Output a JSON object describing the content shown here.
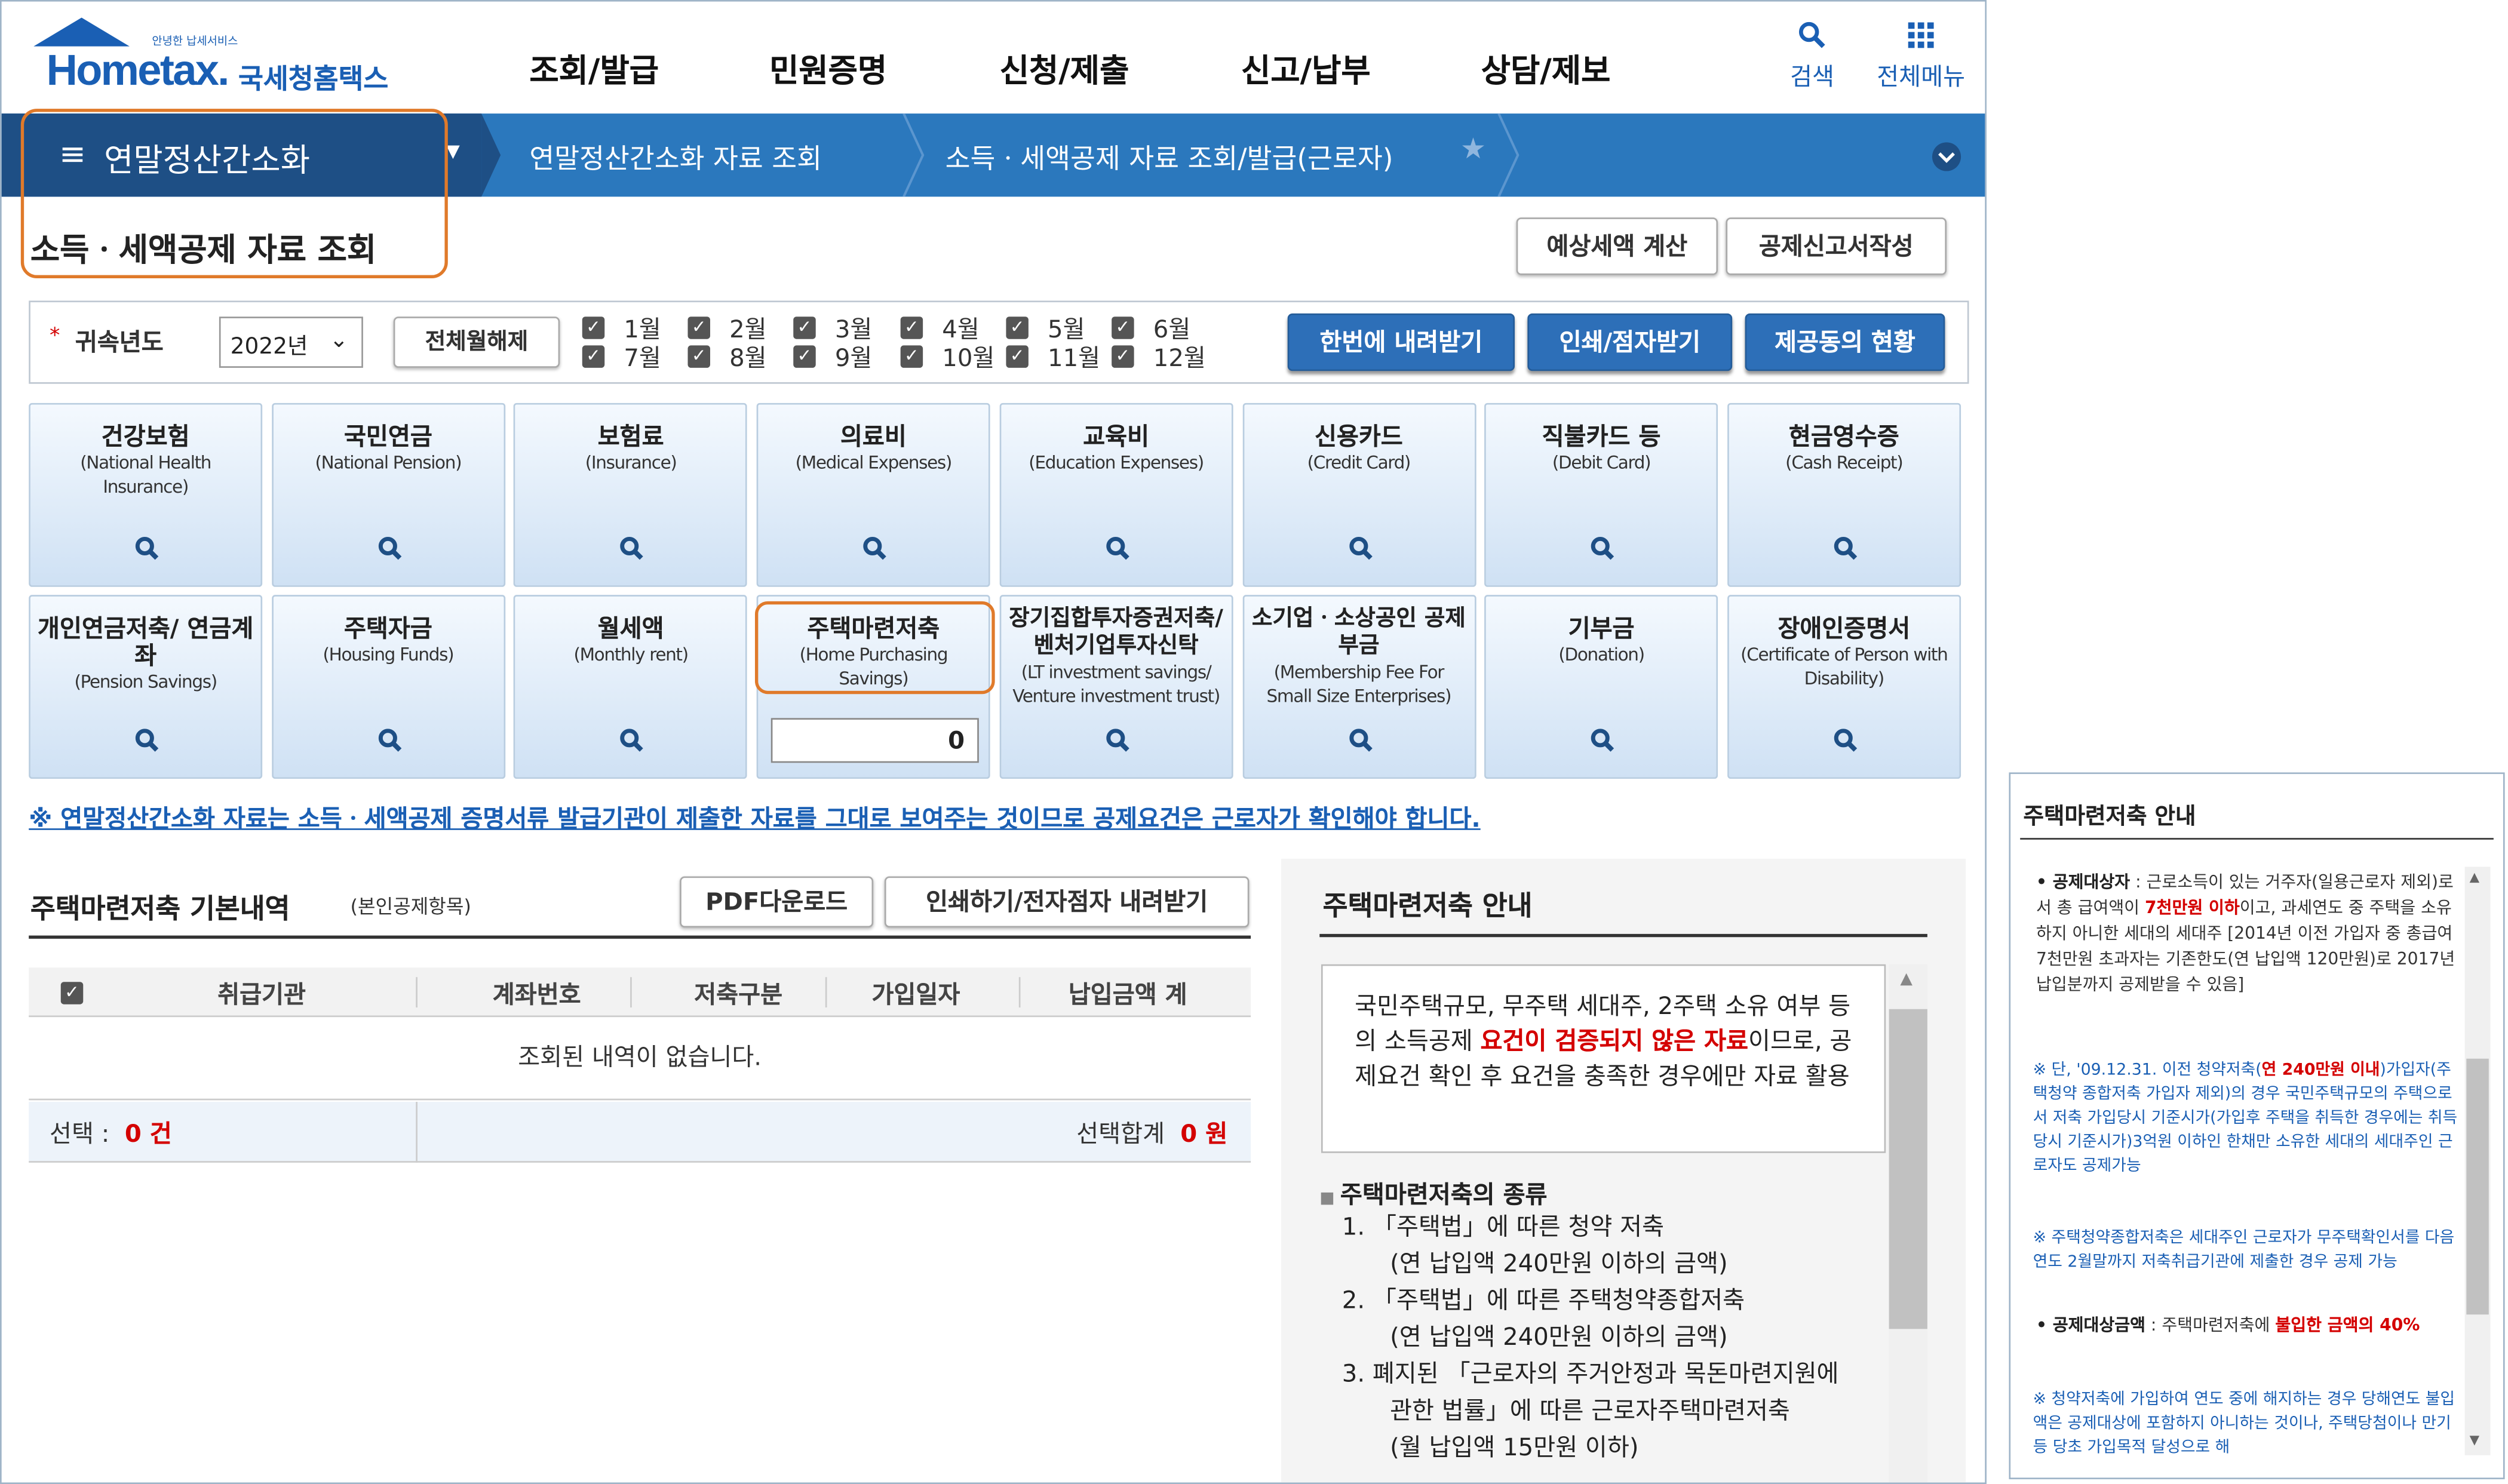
{
  "header": {
    "logo_small": "안녕한 납세서비스",
    "logo_word": "Hometax.",
    "logo_ko": "국세청홈택스",
    "gnb": [
      "조회/발급",
      "민원증명",
      "신청/제출",
      "신고/납부",
      "상담/제보"
    ],
    "search": "검색",
    "menu": "전체메뉴"
  },
  "nav": {
    "home": "연말정산간소화",
    "crumb1": "연말정산간소화 자료 조회",
    "crumb2": "소득ㆍ세액공제 자료 조회/발급(근로자)"
  },
  "page_title": "소득ㆍ세액공제 자료 조회",
  "top_buttons": [
    "예상세액 계산",
    "공제신고서작성"
  ],
  "filter": {
    "year_label": "귀속년도",
    "year_value": "2022년",
    "clear_label": "전체월해제",
    "months_top": [
      "1월",
      "2월",
      "3월",
      "4월",
      "5월",
      "6월"
    ],
    "months_bottom": [
      "7월",
      "8월",
      "9월",
      "10월",
      "11월",
      "12월"
    ],
    "btn_download": "한번에 내려받기",
    "btn_print": "인쇄/점자받기",
    "btn_consent": "제공동의 현황"
  },
  "cards_row1": [
    {
      "k": "건강보험",
      "e": "(National Health Insurance)"
    },
    {
      "k": "국민연금",
      "e": "(National Pension)"
    },
    {
      "k": "보험료",
      "e": "(Insurance)"
    },
    {
      "k": "의료비",
      "e": "(Medical Expenses)"
    },
    {
      "k": "교육비",
      "e": "(Education Expenses)"
    },
    {
      "k": "신용카드",
      "e": "(Credit Card)"
    },
    {
      "k": "직불카드 등",
      "e": "(Debit Card)"
    },
    {
      "k": "현금영수증",
      "e": "(Cash Receipt)"
    }
  ],
  "cards_row2": [
    {
      "k": "개인연금저축/ 연금계좌",
      "e": "(Pension Savings)"
    },
    {
      "k": "주택자금",
      "e": "(Housing Funds)"
    },
    {
      "k": "월세액",
      "e": "(Monthly rent)"
    },
    {
      "k": "주택마련저축",
      "e": "(Home Purchasing Savings)",
      "value": "0"
    },
    {
      "k": "장기집합투자증권저축/ 벤처기업투자신탁",
      "e": "(LT investment savings/ Venture investment trust)"
    },
    {
      "k": "소기업ㆍ소상공인 공제부금",
      "e": "(Membership Fee For Small Size Enterprises)"
    },
    {
      "k": "기부금",
      "e": "(Donation)"
    },
    {
      "k": "장애인증명서",
      "e": "(Certificate of Person with Disability)"
    }
  ],
  "notice": "※ 연말정산간소화 자료는 소득ㆍ세액공제 증명서류 발급기관이 제출한 자료를 그대로 보여주는 것이므로 공제요건은 근로자가 확인해야 합니다.",
  "detail": {
    "title": "주택마련저축 기본내역",
    "title_sub": "(본인공제항목)",
    "btn_pdf": "PDF다운로드",
    "btn_print": "인쇄하기/전자점자 내려받기",
    "columns": [
      "취급기관",
      "계좌번호",
      "저축구분",
      "가입일자",
      "납입금액 계"
    ],
    "empty": "조회된 내역이 없습니다.",
    "sel_label": "선택 :",
    "sel_count": "0 건",
    "sum_label": "선택합계",
    "sum_value": "0 원"
  },
  "guide": {
    "title": "주택마련저축 안내",
    "box_a": "국민주택규모, 무주택 세대주, 2주택 소유 여부 등의 소득공제 ",
    "box_red": "요건이 검증되지 않은 자료",
    "box_b": "이므로, 공제요건 확인 후 요건을 충족한 경우에만 자료 활용",
    "kinds_title": "주택마련저축의 종류",
    "kinds": [
      "1. 「주택법」에 따른 청약 저축",
      "(연 납입액 240만원 이하의 금액)",
      "2. 「주택법」에 따른 주택청약종합저축",
      "(연 납입액 240만원 이하의 금액)",
      "3. 폐지된 「근로자의 주거안정과 목돈마련지원에",
      "관한 법률」에 따른 근로자주택마련저축",
      "(월 납입액 15만원 이하)"
    ]
  },
  "side": {
    "title": "주택마련저축 안내",
    "p1_label": "공제대상자",
    "p1_a": " : 근로소득이 있는 거주자(일용근로자 제외)로서 총 급여액이 ",
    "p1_red": "7천만원 이하",
    "p1_b": "이고, 과세연도 중 주택을 소유하지 아니한 세대의 세대주 [2014년 이전 가입자 중 총급여 7천만원 초과자는 기존한도(연 납입액 120만원)로 2017년 납입분까지 공제받을 수 있음]",
    "n1_a": "※ 단, '09.12.31. 이전 청약저축(",
    "n1_red": "연 240만원 이내",
    "n1_b": ")가입자(주택청약 종합저축 가입자 제외)의 경우 국민주택규모의 주택으로서 저축 가입당시 기준시가(가입후 주택을 취득한 경우에는 취득 당시 기준시가)3억원 이하인 한채만 소유한 세대의 세대주인 근로자도 공제가능",
    "n2": "※ 주택청약종합저축은 세대주인 근로자가 무주택확인서를 다음연도 2월말까지 저축취급기관에 제출한 경우 공제 가능",
    "p2_label": "공제대상금액",
    "p2_a": " : 주택마련저축에 ",
    "p2_red": "불입한 금액의 40%",
    "n3": "※ 청약저축에 가입하여 연도 중에 해지하는 경우 당해연도 불입액은 공제대상에 포함하지 아니하는 것이나, 주택당첨이나 만기 등 당초 가입목적 달성으로 해"
  }
}
